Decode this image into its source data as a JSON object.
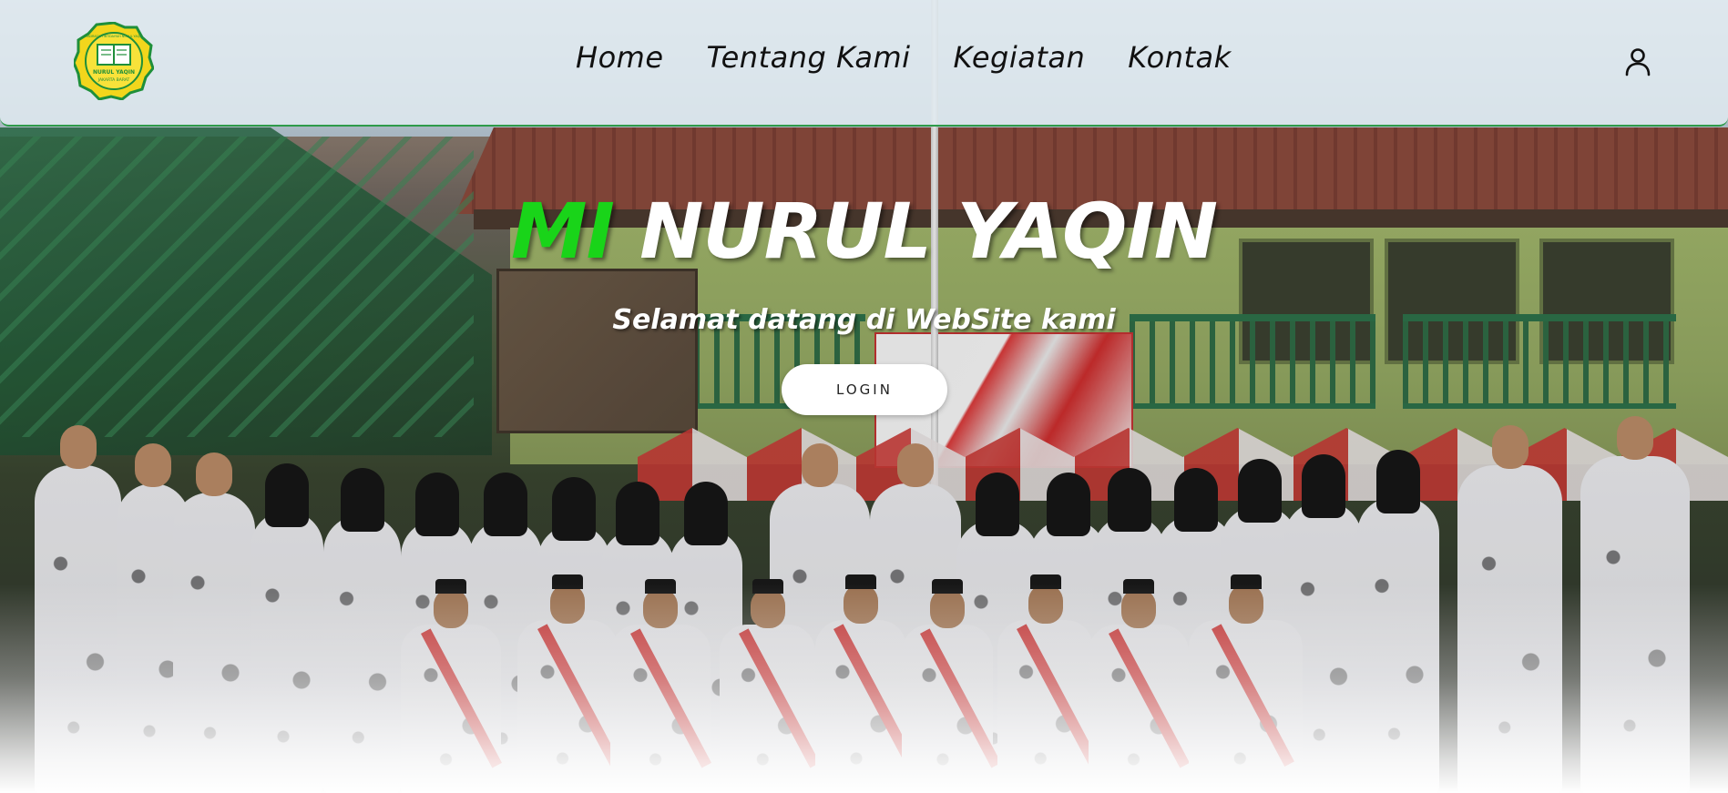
{
  "navbar": {
    "logo_icon": "school-logo-icon",
    "logo_text_top": "MADRASAH IBTIDAIYAH NURUL YAQIN",
    "logo_text_bottom": "NURUL YAQIN",
    "logo_text_city": "JAKARTA BARAT",
    "links": [
      {
        "label": "Home"
      },
      {
        "label": "Tentang Kami"
      },
      {
        "label": "Kegiatan"
      },
      {
        "label": "Kontak"
      }
    ],
    "user_icon": "user-icon"
  },
  "hero": {
    "title_accent": "MI",
    "title_rest": "NURUL YAQIN",
    "subtitle": "Selamat datang di WebSite kami",
    "login_label": "LOGIN",
    "image": "group-photo-school-students-teachers"
  },
  "colors": {
    "accent_green": "#19d419",
    "navbar_border": "#2e9b4a",
    "logo_yellow": "#f2d61c",
    "logo_green": "#1f8f3a"
  }
}
